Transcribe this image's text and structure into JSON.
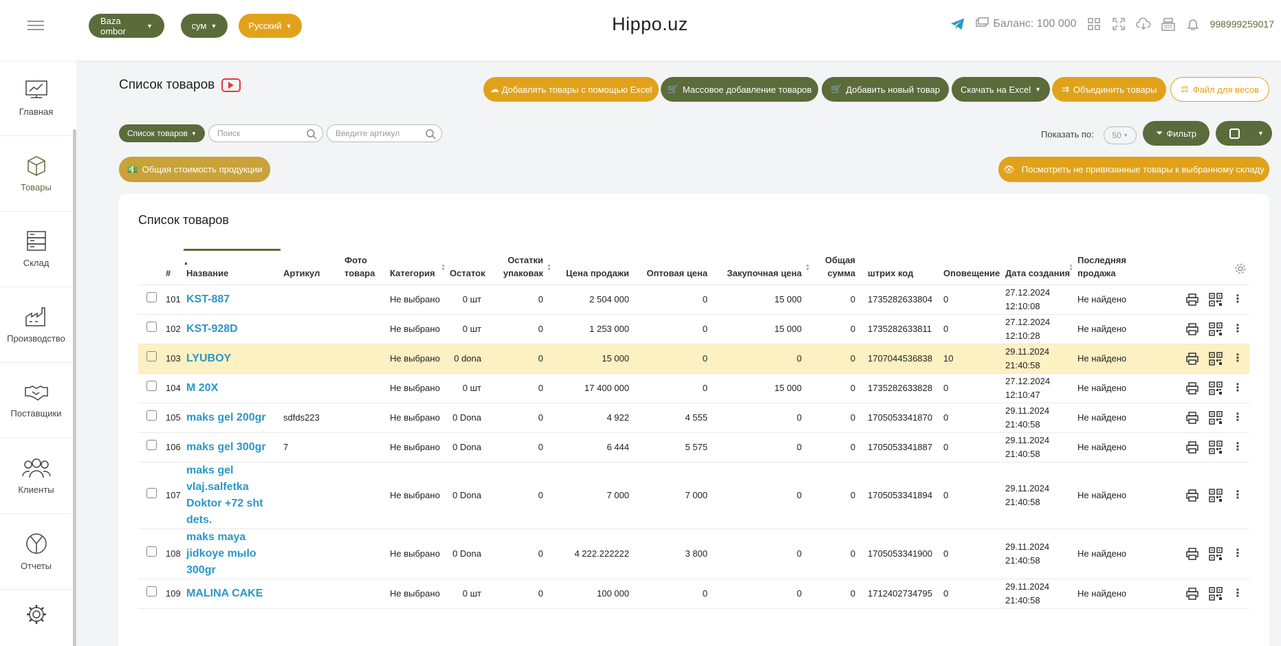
{
  "topbar": {
    "warehouse": "Baza ombor",
    "currency": "сум",
    "language": "Русский",
    "brand": "Hippo.uz",
    "balance": "Баланс: 100 000",
    "phone": "998999259017"
  },
  "sidebar": {
    "items": [
      {
        "label": "Главная"
      },
      {
        "label": "Товары"
      },
      {
        "label": "Склад"
      },
      {
        "label": "Производство"
      },
      {
        "label": "Поставщики"
      },
      {
        "label": "Клиенты"
      },
      {
        "label": "Отчеты"
      }
    ]
  },
  "header": {
    "title": "Список товаров"
  },
  "actions": {
    "add_excel": "Добавлять товары с помощью Excel",
    "bulk_add": "Массовое добавление товаров",
    "add_new": "Добавить новый товар",
    "download_excel": "Скачать на Excel",
    "merge": "Объединить товары",
    "scales_file": "Файл для весов"
  },
  "toolbar": {
    "list_select": "Список товаров",
    "search_placeholder": "Поиск",
    "article_placeholder": "Введите артикул",
    "show_label": "Показать по:",
    "page_size": "50",
    "filter": "Фильтр",
    "total_cost": "Общая стоимость продукции",
    "unlinked": "Посмотреть не привязанные товары к выбранному складу"
  },
  "table": {
    "title": "Список товаров",
    "headers": {
      "num": "#",
      "name": "Название",
      "article": "Артикул",
      "photo": "Фото товара",
      "category": "Категория",
      "stock": "Остаток",
      "pack_stock": "Остатки упаковак",
      "sale_price": "Цена продажи",
      "wholesale": "Оптовая цена",
      "purchase": "Закупочная цена",
      "total": "Общая сумма",
      "barcode": "штрих код",
      "alert": "Оповещение",
      "created": "Дата создания",
      "last_sale": "Последняя продажа"
    },
    "rows": [
      {
        "num": "101",
        "name": "KST-887",
        "article": "",
        "category": "Не выбрано",
        "stock": "0 шт",
        "pack": "0",
        "sale": "2 504 000",
        "wholesale": "0",
        "purchase": "15 000",
        "total": "0",
        "barcode": "1735282633804",
        "alert": "0",
        "date": "27.12.2024",
        "time": "12:10:08",
        "last": "Не найдено"
      },
      {
        "num": "102",
        "name": "KST-928D",
        "article": "",
        "category": "Не выбрано",
        "stock": "0 шт",
        "pack": "0",
        "sale": "1 253 000",
        "wholesale": "0",
        "purchase": "15 000",
        "total": "0",
        "barcode": "1735282633811",
        "alert": "0",
        "date": "27.12.2024",
        "time": "12:10:28",
        "last": "Не найдено"
      },
      {
        "num": "103",
        "name": "LYUBOY",
        "article": "",
        "category": "Не выбрано",
        "stock": "0 dona",
        "pack": "0",
        "sale": "15 000",
        "wholesale": "0",
        "purchase": "0",
        "total": "0",
        "barcode": "1707044536838",
        "alert": "10",
        "date": "29.11.2024",
        "time": "21:40:58",
        "last": "Не найдено"
      },
      {
        "num": "104",
        "name": "M 20X",
        "article": "",
        "category": "Не выбрано",
        "stock": "0 шт",
        "pack": "0",
        "sale": "17 400 000",
        "wholesale": "0",
        "purchase": "15 000",
        "total": "0",
        "barcode": "1735282633828",
        "alert": "0",
        "date": "27.12.2024",
        "time": "12:10:47",
        "last": "Не найдено"
      },
      {
        "num": "105",
        "name": "maks gel 200gr",
        "article": "sdfds223",
        "category": "Не выбрано",
        "stock": "0 Dona",
        "pack": "0",
        "sale": "4 922",
        "wholesale": "4 555",
        "purchase": "0",
        "total": "0",
        "barcode": "1705053341870",
        "alert": "0",
        "date": "29.11.2024",
        "time": "21:40:58",
        "last": "Не найдено"
      },
      {
        "num": "106",
        "name": "maks gel 300gr",
        "article": "7",
        "category": "Не выбрано",
        "stock": "0 Dona",
        "pack": "0",
        "sale": "6 444",
        "wholesale": "5 575",
        "purchase": "0",
        "total": "0",
        "barcode": "1705053341887",
        "alert": "0",
        "date": "29.11.2024",
        "time": "21:40:58",
        "last": "Не найдено"
      },
      {
        "num": "107",
        "name": "maks gel vlaj.salfetka Doktor +72 sht dets.",
        "article": "",
        "category": "Не выбрано",
        "stock": "0 Dona",
        "pack": "0",
        "sale": "7 000",
        "wholesale": "7 000",
        "purchase": "0",
        "total": "0",
        "barcode": "1705053341894",
        "alert": "0",
        "date": "29.11.2024",
        "time": "21:40:58",
        "last": "Не найдено"
      },
      {
        "num": "108",
        "name": "maks maya jidkoye mыlo 300gr",
        "article": "",
        "category": "Не выбрано",
        "stock": "0 Dona",
        "pack": "0",
        "sale": "4 222.222222",
        "wholesale": "3 800",
        "purchase": "0",
        "total": "0",
        "barcode": "1705053341900",
        "alert": "0",
        "date": "29.11.2024",
        "time": "21:40:58",
        "last": "Не найдено"
      },
      {
        "num": "109",
        "name": "MALINA CAKE",
        "article": "",
        "category": "Не выбрано",
        "stock": "0 шт",
        "pack": "0",
        "sale": "100 000",
        "wholesale": "0",
        "purchase": "0",
        "total": "0",
        "barcode": "1712402734795",
        "alert": "0",
        "date": "29.11.2024",
        "time": "21:40:58",
        "last": "Не найдено"
      }
    ]
  },
  "colors": {
    "olive": "#5b6b3a",
    "gold": "#e1a21b",
    "link": "#2a97c9",
    "highlight": "#fdf0c2"
  }
}
